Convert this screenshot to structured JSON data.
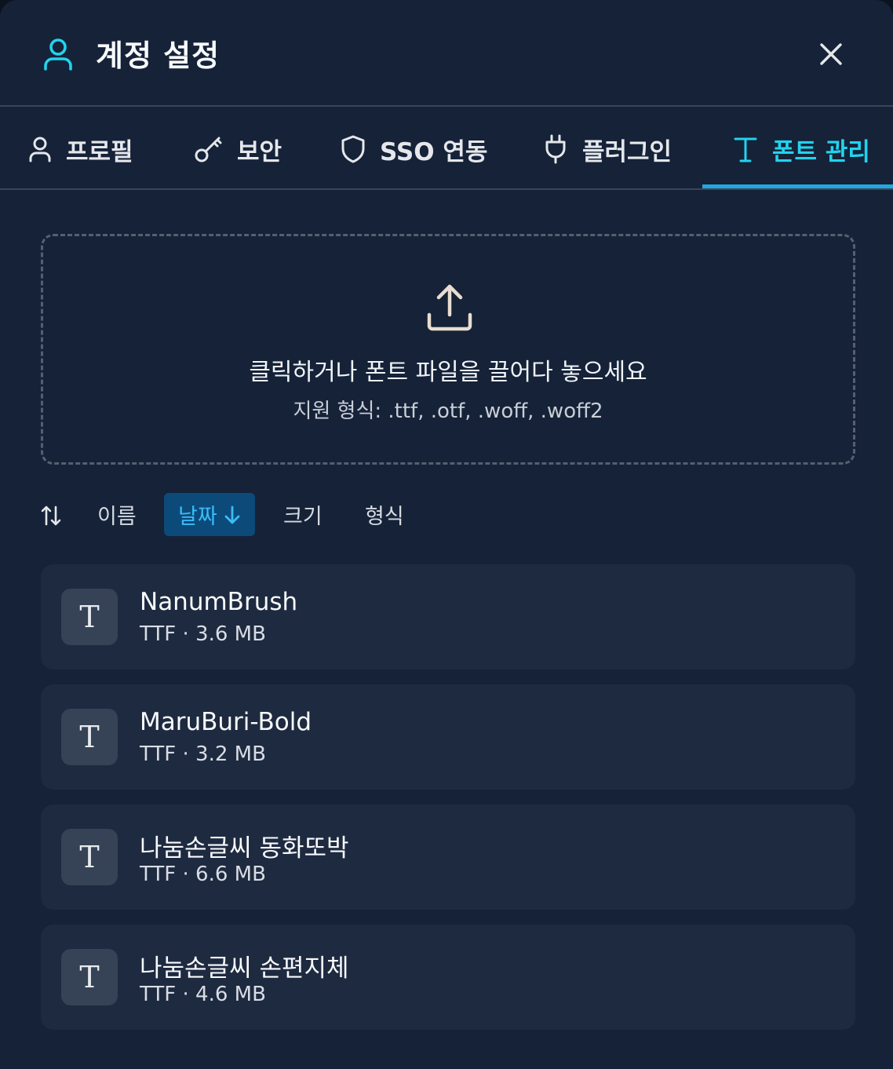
{
  "dialog": {
    "title": "계정 설정",
    "icons": {
      "title": "user-icon",
      "close": "close-icon"
    }
  },
  "tabs": [
    {
      "label": "프로필",
      "icon": "user-icon"
    },
    {
      "label": "보안",
      "icon": "key-icon"
    },
    {
      "label": "SSO 연동",
      "icon": "shield-icon"
    },
    {
      "label": "플러그인",
      "icon": "plug-icon"
    },
    {
      "label": "폰트 관리",
      "icon": "type-icon",
      "active": true
    }
  ],
  "dropzone": {
    "icon": "upload-icon",
    "title": "클릭하거나 폰트 파일을 끌어다 놓으세요",
    "subtitle": "지원 형식: .ttf, .otf, .woff, .woff2"
  },
  "sort": {
    "icon": "sort-icon",
    "options": [
      {
        "label": "이름"
      },
      {
        "label": "날짜",
        "active": true,
        "direction": "desc"
      },
      {
        "label": "크기"
      },
      {
        "label": "형식"
      }
    ]
  },
  "fonts": [
    {
      "thumb": "T",
      "name": "NanumBrush",
      "meta": "TTF · 3.6 MB"
    },
    {
      "thumb": "T",
      "name": "MaruBuri-Bold",
      "meta": "TTF · 3.2 MB"
    },
    {
      "thumb": "T",
      "name": "나눔손글씨 동화또박",
      "meta": "TTF · 6.6 MB"
    },
    {
      "thumb": "T",
      "name": "나눔손글씨 손편지체",
      "meta": "TTF · 4.6 MB"
    }
  ],
  "colors": {
    "background": "#152238",
    "card": "#1e2a40",
    "accent": "#22d3ee",
    "active_sort_bg": "#0c4a7a"
  }
}
